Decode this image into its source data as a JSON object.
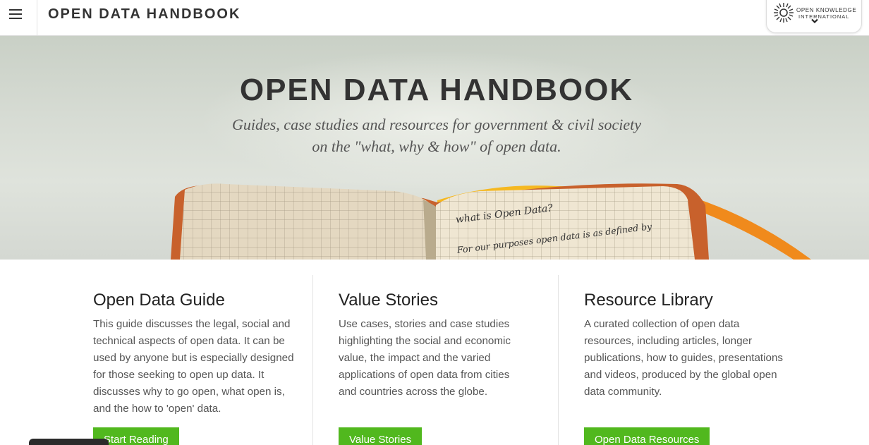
{
  "header": {
    "title": "OPEN DATA HANDBOOK",
    "org_line1": "OPEN KNOWLEDGE",
    "org_line2": "INTERNATIONAL"
  },
  "hero": {
    "title": "OPEN DATA HANDBOOK",
    "subtitle_line1": "Guides, case studies and resources for government & civil society",
    "subtitle_line2": "on the \"what, why & how\" of open data.",
    "notebook_heading": "what is Open Data?",
    "notebook_line": "For our purposes open data is as defined by"
  },
  "sections": [
    {
      "title": "Open Data Guide",
      "text": "This guide discusses the legal, social and technical aspects of open data. It can be used by anyone but is especially designed for those seeking to open up data. It discusses why to go open, what open is, and the how to 'open' data.",
      "button": "Start Reading"
    },
    {
      "title": "Value Stories",
      "text": "Use cases, stories and case studies highlighting the social and economic value, the impact and the varied applications of open data from cities and countries across the globe.",
      "button": "Value Stories"
    },
    {
      "title": "Resource Library",
      "text": "A curated collection of open data resources, including articles, longer publications, how to guides, presentations and videos, produced by the global open data community.",
      "button": "Open Data Resources"
    }
  ],
  "icons": {
    "menu": "hamburger-menu-icon",
    "org_logo": "okfn-burst-logo",
    "dropdown": "chevron-down-icon"
  },
  "colors": {
    "accent": "#51b81e",
    "notebook_cover": "#c8612c",
    "ribbon": "#f08a1c"
  }
}
